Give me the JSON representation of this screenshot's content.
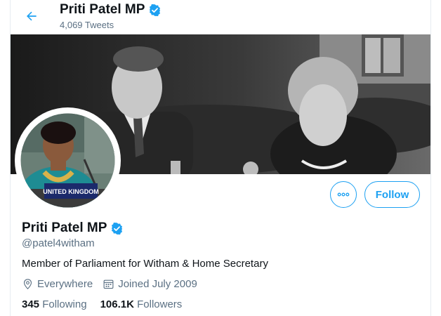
{
  "header": {
    "name": "Priti Patel MP",
    "tweet_count": "4,069 Tweets"
  },
  "profile": {
    "name": "Priti Patel MP",
    "handle": "@patel4witham",
    "bio": "Member of Parliament for Witham & Home Secretary",
    "location": "Everywhere",
    "joined": "Joined July 2009",
    "following_count": "345",
    "following_label": "Following",
    "followers_count": "106.1K",
    "followers_label": "Followers",
    "avatar_placard_text": "UNITED KINGDOM"
  },
  "actions": {
    "follow_label": "Follow"
  },
  "icons": {
    "back": "arrow-left-icon",
    "verified": "verified-badge-icon",
    "more": "more-icon",
    "location": "location-pin-icon",
    "calendar": "calendar-icon"
  },
  "colors": {
    "accent": "#1da1f2",
    "text": "#0f1419",
    "muted": "#5b7083",
    "border": "#e6ecf0"
  }
}
